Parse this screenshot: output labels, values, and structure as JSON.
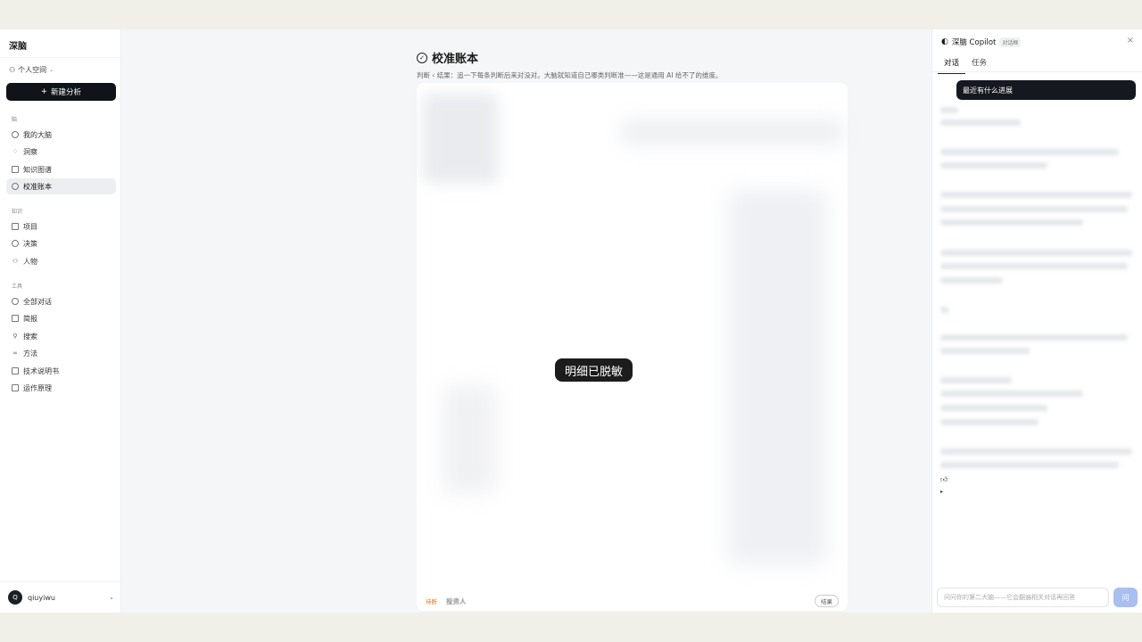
{
  "sidebar": {
    "app_title": "深脑",
    "space_label": "个人空间",
    "new_button": "新建分析",
    "group_brain": "脑",
    "brain_items": [
      {
        "label": "我的大脑",
        "icon": "brain-icon"
      },
      {
        "label": "洞察",
        "icon": "bulb-icon"
      },
      {
        "label": "知识图谱",
        "icon": "book-icon"
      },
      {
        "label": "校准账本",
        "icon": "check-circle-icon"
      }
    ],
    "group_knowledge": "知识",
    "knowledge_items": [
      {
        "label": "项目",
        "icon": "folder-icon"
      },
      {
        "label": "决策",
        "icon": "check-icon"
      },
      {
        "label": "人物",
        "icon": "people-icon"
      }
    ],
    "group_tools": "工具",
    "tool_items": [
      {
        "label": "全部对话",
        "icon": "history-icon"
      },
      {
        "label": "简报",
        "icon": "doc-icon"
      },
      {
        "label": "搜索",
        "icon": "search-icon"
      },
      {
        "label": "方法",
        "icon": "link-icon"
      },
      {
        "label": "技术说明书",
        "icon": "manual-icon"
      },
      {
        "label": "运作原理",
        "icon": "info-icon"
      }
    ],
    "user_name": "qiuyiwu",
    "user_initial": "Q"
  },
  "main": {
    "title": "校准账本",
    "description": "判断 ‹ 结果：追一下每条判断后来对没对。大脑就知道自己哪类判断准——这是通用 AI 给不了的维度。",
    "masked_label": "明细已脱敏",
    "bottom_tag": "待断",
    "bottom_text": "投资人",
    "bottom_pill": "结果"
  },
  "copilot": {
    "title": "深脑 Copilot",
    "badge": "对话框",
    "tabs": [
      "对话",
      "任务"
    ],
    "user_message": "最近有什么进展",
    "input_placeholder": "问问你的第二大脑——它会翻遍相关对话再回答",
    "send_label": "问"
  }
}
